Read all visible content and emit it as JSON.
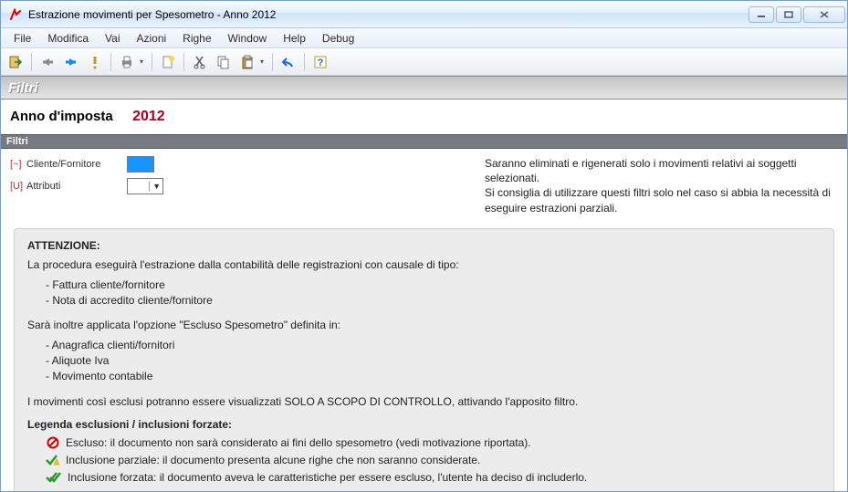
{
  "window": {
    "title": "Estrazione movimenti per Spesometro - Anno 2012"
  },
  "menubar": {
    "items": [
      "File",
      "Modifica",
      "Vai",
      "Azioni",
      "Righe",
      "Window",
      "Help",
      "Debug"
    ]
  },
  "banner": {
    "title": "Filtri"
  },
  "year": {
    "label": "Anno d'imposta",
    "value": "2012"
  },
  "subheader": {
    "label": "Filtri"
  },
  "filters": {
    "cliente": {
      "shortcut": "[~]",
      "label": "Cliente/Fornitore",
      "value": ""
    },
    "attributi": {
      "shortcut": "[U]",
      "label": "Attributi",
      "selected": ""
    },
    "note": "Saranno eliminati e rigenerati solo i movimenti relativi ai soggetti selezionati.\nSi consiglia di utilizzare questi filtri solo nel caso si abbia la necessità di eseguire estrazioni parziali."
  },
  "info": {
    "heading": "ATTENZIONE:",
    "p1": "La procedura eseguirà l'estrazione dalla contabilità delle registrazioni con causale di tipo:",
    "list1": [
      "Fattura cliente/fornitore",
      "Nota di accredito cliente/fornitore"
    ],
    "p2": "Sarà inoltre applicata l'opzione \"Escluso Spesometro\" definita in:",
    "list2": [
      "Anagrafica clienti/fornitori",
      "Aliquote Iva",
      "Movimento contabile"
    ],
    "p3": "I movimenti così esclusi potranno essere visualizzati SOLO A SCOPO DI CONTROLLO, attivando l'apposito filtro.",
    "legend_title": "Legenda esclusioni / inclusioni forzate:",
    "legend": [
      {
        "icon": "forbidden",
        "text": "Escluso: il documento non sarà considerato ai fini dello spesometro (vedi motivazione riportata)."
      },
      {
        "icon": "check-warn",
        "text": "Inclusione parziale: il documento presenta alcune righe che non saranno considerate."
      },
      {
        "icon": "check-double",
        "text": "Inclusione forzata: il documento aveva le caratteristiche per essere escluso, l'utente ha deciso di includerlo."
      }
    ]
  }
}
